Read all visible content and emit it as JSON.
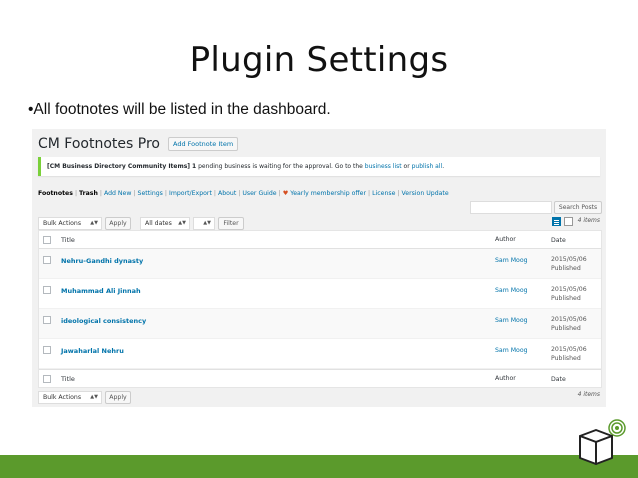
{
  "slide": {
    "title": "Plugin Settings",
    "bullet": "•All footnotes will be listed in the dashboard."
  },
  "header": {
    "title": "CM Footnotes Pro",
    "add_button": "Add Footnote Item"
  },
  "notice": {
    "prefix": "[CM Business Directory Community Items]",
    "count": "1",
    "text": " pending business is waiting for the approval. Go to the ",
    "link1": "business list",
    "or": " or ",
    "link2": "publish all",
    "end": "."
  },
  "subsubsub": {
    "items": [
      "Footnotes",
      "Trash",
      "Add New",
      "Settings",
      "Import/Export",
      "About",
      "User Guide",
      "Yearly membership offer",
      "License",
      "Version Update"
    ]
  },
  "search": {
    "button": "Search Posts",
    "placeholder": ""
  },
  "filters": {
    "bulk_actions": "Bulk Actions",
    "apply": "Apply",
    "all_dates": "All dates",
    "filter": "Filter",
    "items_count": "4 items"
  },
  "table": {
    "columns": {
      "title": "Title",
      "author": "Author",
      "date": "Date"
    },
    "rows": [
      {
        "title": "Nehru-Gandhi dynasty",
        "author": "Sam Moog",
        "date": "2015/05/06",
        "status": "Published"
      },
      {
        "title": "Muhammad Ali Jinnah",
        "author": "Sam Moog",
        "date": "2015/05/06",
        "status": "Published"
      },
      {
        "title": "ideological consistency",
        "author": "Sam Moog",
        "date": "2015/05/06",
        "status": "Published"
      },
      {
        "title": "Jawaharlal Nehru",
        "author": "Sam Moog",
        "date": "2015/05/06",
        "status": "Published"
      }
    ]
  },
  "colors": {
    "accent": "#0073aa",
    "footer_bar": "#5b9a2c",
    "notice_border": "#7ad03a"
  },
  "icons": [
    "heart-icon",
    "list-view-icon",
    "excerpt-view-icon",
    "cube-logo-icon"
  ]
}
